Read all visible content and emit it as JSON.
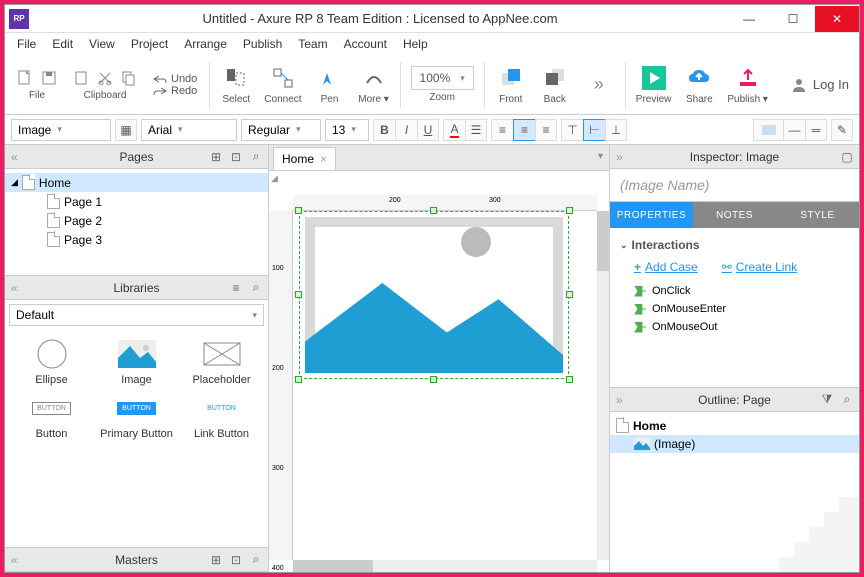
{
  "title": "Untitled - Axure RP 8 Team Edition : Licensed to AppNee.com",
  "menu": [
    "File",
    "Edit",
    "View",
    "Project",
    "Arrange",
    "Publish",
    "Team",
    "Account",
    "Help"
  ],
  "toolbar": {
    "file": "File",
    "clipboard": "Clipboard",
    "undo": "Undo",
    "redo": "Redo",
    "select": "Select",
    "connect": "Connect",
    "pen": "Pen",
    "more": "More ▾",
    "zoom": "Zoom",
    "zoom_val": "100%",
    "front": "Front",
    "back": "Back",
    "preview": "Preview",
    "share": "Share",
    "publish": "Publish ▾",
    "login": "Log In"
  },
  "fmt": {
    "widget": "Image",
    "font": "Arial",
    "weight": "Regular",
    "size": "13",
    "bold": "B",
    "italic": "I",
    "underline": "U"
  },
  "panels": {
    "pages": "Pages",
    "libraries": "Libraries",
    "masters": "Masters",
    "inspector": "Inspector: Image",
    "outline": "Outline: Page"
  },
  "pages": {
    "root": "Home",
    "p1": "Page 1",
    "p2": "Page 2",
    "p3": "Page 3"
  },
  "lib": {
    "selected": "Default",
    "ellipse": "Ellipse",
    "image": "Image",
    "placeholder": "Placeholder",
    "button": "Button",
    "pbutton": "Primary Button",
    "lbutton": "Link Button",
    "btn_caps": "BUTTON"
  },
  "tab": {
    "name": "Home"
  },
  "ruler": {
    "h200": "200",
    "h300": "300",
    "v100": "100",
    "v200": "200",
    "v300": "300",
    "v400": "400"
  },
  "inspector": {
    "name": "(Image Name)",
    "interactions": "Interactions",
    "addcase": "Add Case",
    "createlink": "Create Link",
    "onclick": "OnClick",
    "onmouseenter": "OnMouseEnter",
    "onmouseout": "OnMouseOut",
    "tabs": {
      "prop": "PROPERTIES",
      "notes": "NOTES",
      "style": "STYLE"
    }
  },
  "outline": {
    "root": "Home",
    "item": "(Image)"
  }
}
